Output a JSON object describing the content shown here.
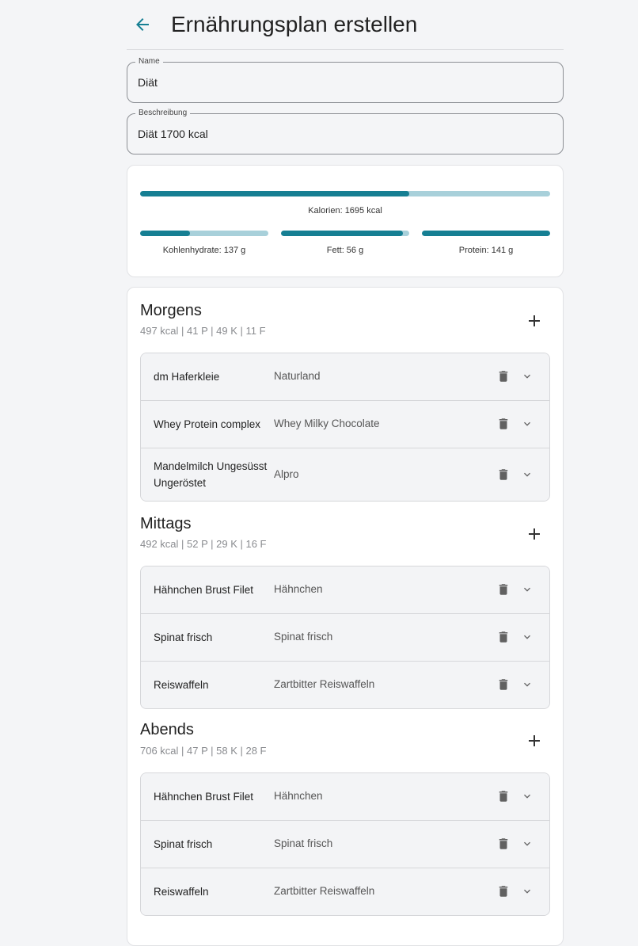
{
  "header": {
    "title": "Ernährungsplan erstellen"
  },
  "form": {
    "name_label": "Name",
    "name_value": "Diät",
    "description_label": "Beschreibung",
    "description_value": "Diät 1700 kcal"
  },
  "nutrition": {
    "calories": {
      "label": "Kalorien: 1695 kcal",
      "progress": 0.656
    },
    "carbs": {
      "label": "Kohlenhydrate: 137 g",
      "progress": 0.39
    },
    "fat": {
      "label": "Fett: 56 g",
      "progress": 0.95
    },
    "protein": {
      "label": "Protein: 141 g",
      "progress": 1.0
    }
  },
  "meals": [
    {
      "title": "Morgens",
      "summary": "497 kcal | 41 P | 49 K | 11 F",
      "items": [
        {
          "name": "dm Haferkleie",
          "brand": "Naturland"
        },
        {
          "name": "Whey Protein complex",
          "brand": "Whey Milky Chocolate"
        },
        {
          "name": "Mandelmilch Ungesüsst Ungeröstet",
          "brand": "Alpro"
        }
      ]
    },
    {
      "title": "Mittags",
      "summary": "492 kcal | 52 P | 29 K | 16 F",
      "items": [
        {
          "name": "Hähnchen Brust Filet",
          "brand": "Hähnchen"
        },
        {
          "name": "Spinat frisch",
          "brand": "Spinat frisch"
        },
        {
          "name": "Reiswaffeln",
          "brand": "Zartbitter Reiswaffeln"
        }
      ]
    },
    {
      "title": "Abends",
      "summary": "706 kcal | 47 P | 58 K | 28 F",
      "items": [
        {
          "name": "Hähnchen Brust Filet",
          "brand": "Hähnchen"
        },
        {
          "name": "Spinat frisch",
          "brand": "Spinat frisch"
        },
        {
          "name": "Reiswaffeln",
          "brand": "Zartbitter Reiswaffeln"
        }
      ]
    }
  ],
  "colors": {
    "accent": "#167f93",
    "track": "#a8d0da",
    "icon": "#616161"
  },
  "icons": {
    "back": "arrow-left-icon",
    "add": "plus-icon",
    "delete": "trash-icon",
    "expand": "chevron-down-icon"
  }
}
